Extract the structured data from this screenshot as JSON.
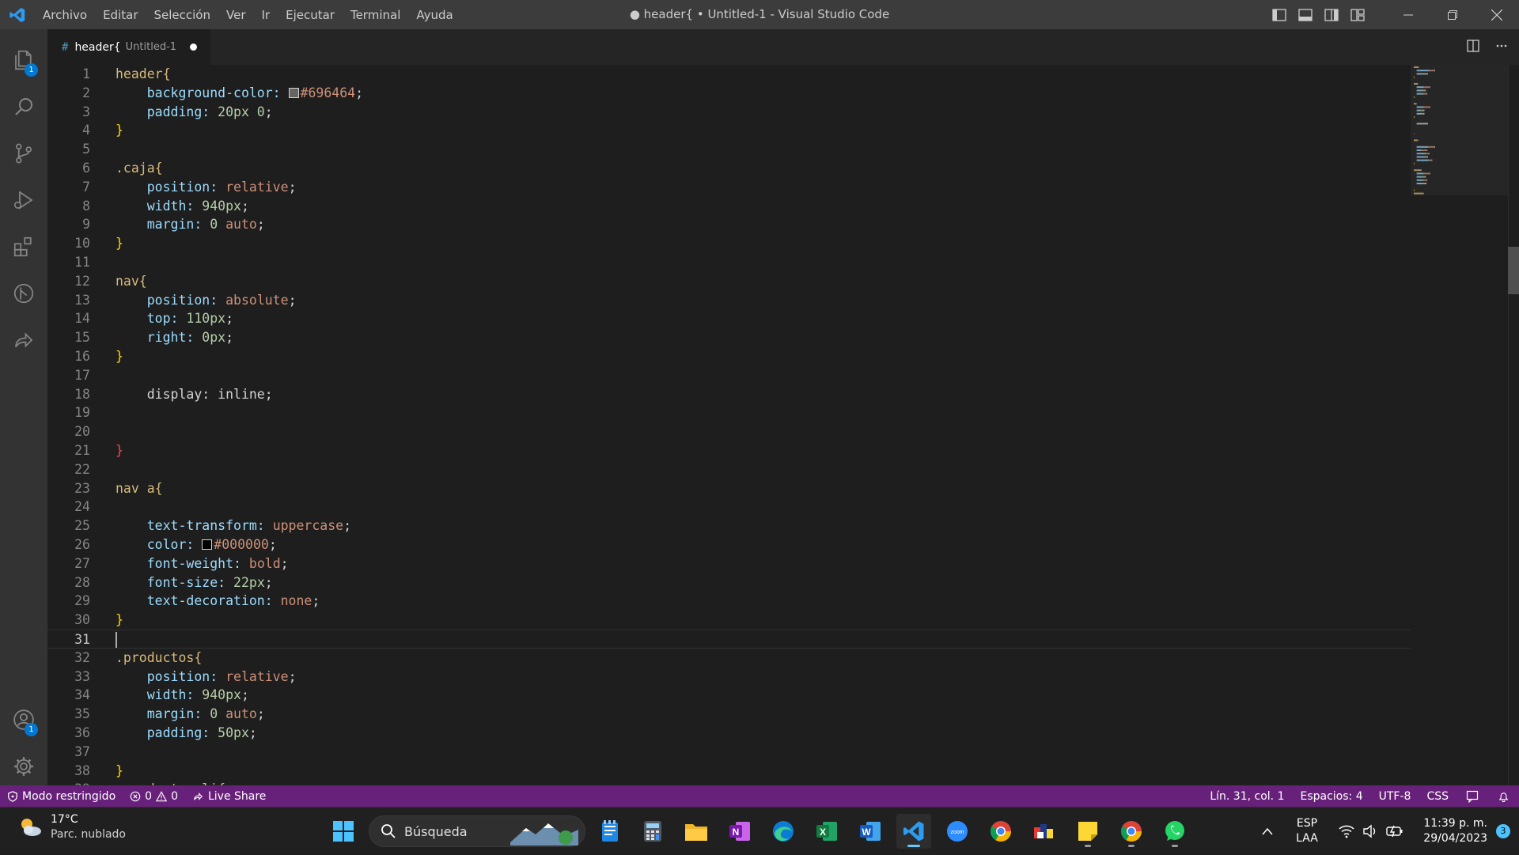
{
  "window": {
    "title": "● header{ • Untitled-1 - Visual Studio Code",
    "menu": [
      "Archivo",
      "Editar",
      "Selección",
      "Ver",
      "Ir",
      "Ejecutar",
      "Terminal",
      "Ayuda"
    ]
  },
  "activity": {
    "explorer_badge": "1",
    "accounts_badge": "1"
  },
  "tab": {
    "icon": "#",
    "name": "header{",
    "description": "Untitled-1"
  },
  "editor": {
    "lines": [
      [
        {
          "t": "header{",
          "c": "#d7ba7d"
        }
      ],
      [
        {
          "t": "    background-color: ",
          "c": "#9cdcfe"
        },
        {
          "t": "SW:#696464",
          "c": "swatch"
        },
        {
          "t": "#696464",
          "c": "#ce9178"
        },
        {
          "t": ";",
          "c": "#d4d4d4"
        }
      ],
      [
        {
          "t": "    padding: ",
          "c": "#9cdcfe"
        },
        {
          "t": "20px 0",
          "c": "#b5cea8"
        },
        {
          "t": ";",
          "c": "#d4d4d4"
        }
      ],
      [
        {
          "t": "}",
          "c": "#ffd700"
        }
      ],
      [],
      [
        {
          "t": ".caja{",
          "c": "#d7ba7d"
        }
      ],
      [
        {
          "t": "    position: ",
          "c": "#9cdcfe"
        },
        {
          "t": "relative",
          "c": "#ce9178"
        },
        {
          "t": ";",
          "c": "#d4d4d4"
        }
      ],
      [
        {
          "t": "    width: ",
          "c": "#9cdcfe"
        },
        {
          "t": "940px",
          "c": "#b5cea8"
        },
        {
          "t": ";",
          "c": "#d4d4d4"
        }
      ],
      [
        {
          "t": "    margin: ",
          "c": "#9cdcfe"
        },
        {
          "t": "0 ",
          "c": "#b5cea8"
        },
        {
          "t": "auto",
          "c": "#ce9178"
        },
        {
          "t": ";",
          "c": "#d4d4d4"
        }
      ],
      [
        {
          "t": "}",
          "c": "#ffd700"
        }
      ],
      [],
      [
        {
          "t": "nav{",
          "c": "#d7ba7d"
        }
      ],
      [
        {
          "t": "    position: ",
          "c": "#9cdcfe"
        },
        {
          "t": "absolute",
          "c": "#ce9178"
        },
        {
          "t": ";",
          "c": "#d4d4d4"
        }
      ],
      [
        {
          "t": "    top: ",
          "c": "#9cdcfe"
        },
        {
          "t": "110px",
          "c": "#b5cea8"
        },
        {
          "t": ";",
          "c": "#d4d4d4"
        }
      ],
      [
        {
          "t": "    right: ",
          "c": "#9cdcfe"
        },
        {
          "t": "0px",
          "c": "#b5cea8"
        },
        {
          "t": ";",
          "c": "#d4d4d4"
        }
      ],
      [
        {
          "t": "}",
          "c": "#ffd700"
        }
      ],
      [],
      [
        {
          "t": "    display: inline;",
          "c": "#d4d4d4"
        }
      ],
      [],
      [],
      [
        {
          "t": "}",
          "c": "#f44747"
        }
      ],
      [],
      [
        {
          "t": "nav a{",
          "c": "#d7ba7d"
        }
      ],
      [],
      [
        {
          "t": "    text-transform: ",
          "c": "#9cdcfe"
        },
        {
          "t": "uppercase",
          "c": "#ce9178"
        },
        {
          "t": ";",
          "c": "#d4d4d4"
        }
      ],
      [
        {
          "t": "    color: ",
          "c": "#9cdcfe"
        },
        {
          "t": "SW:#000000",
          "c": "swatch"
        },
        {
          "t": "#000000",
          "c": "#ce9178"
        },
        {
          "t": ";",
          "c": "#d4d4d4"
        }
      ],
      [
        {
          "t": "    font-weight: ",
          "c": "#9cdcfe"
        },
        {
          "t": "bold",
          "c": "#ce9178"
        },
        {
          "t": ";",
          "c": "#d4d4d4"
        }
      ],
      [
        {
          "t": "    font-size: ",
          "c": "#9cdcfe"
        },
        {
          "t": "22px",
          "c": "#b5cea8"
        },
        {
          "t": ";",
          "c": "#d4d4d4"
        }
      ],
      [
        {
          "t": "    text-decoration: ",
          "c": "#9cdcfe"
        },
        {
          "t": "none",
          "c": "#ce9178"
        },
        {
          "t": ";",
          "c": "#d4d4d4"
        }
      ],
      [
        {
          "t": "}",
          "c": "#ffd700"
        }
      ],
      [],
      [
        {
          "t": ".productos{",
          "c": "#d7ba7d"
        }
      ],
      [
        {
          "t": "    position: ",
          "c": "#9cdcfe"
        },
        {
          "t": "relative",
          "c": "#ce9178"
        },
        {
          "t": ";",
          "c": "#d4d4d4"
        }
      ],
      [
        {
          "t": "    width: ",
          "c": "#9cdcfe"
        },
        {
          "t": "940px",
          "c": "#b5cea8"
        },
        {
          "t": ";",
          "c": "#d4d4d4"
        }
      ],
      [
        {
          "t": "    margin: ",
          "c": "#9cdcfe"
        },
        {
          "t": "0 ",
          "c": "#b5cea8"
        },
        {
          "t": "auto",
          "c": "#ce9178"
        },
        {
          "t": ";",
          "c": "#d4d4d4"
        }
      ],
      [
        {
          "t": "    padding: ",
          "c": "#9cdcfe"
        },
        {
          "t": "50px",
          "c": "#b5cea8"
        },
        {
          "t": ";",
          "c": "#d4d4d4"
        }
      ],
      [],
      [
        {
          "t": "}",
          "c": "#ffd700"
        }
      ],
      [
        {
          "t": ".productos li{",
          "c": "#d7ba7d"
        }
      ]
    ],
    "active_line": 31
  },
  "status": {
    "restricted": "Modo restringido",
    "errors": "0",
    "warnings": "0",
    "liveshare": "Live Share",
    "position": "Lín. 31, col. 1",
    "spaces": "Espacios: 4",
    "encoding": "UTF-8",
    "language": "CSS"
  },
  "taskbar": {
    "temp": "17°C",
    "weather": "Parc. nublado",
    "search": "Búsqueda",
    "lang1": "ESP",
    "lang2": "LAA",
    "time": "11:39 p. m.",
    "date": "29/04/2023",
    "notif": "3"
  },
  "colors": {
    "statusbar": "#68217a",
    "accent": "#0078d4",
    "titlebar": "#3c3c3c"
  }
}
